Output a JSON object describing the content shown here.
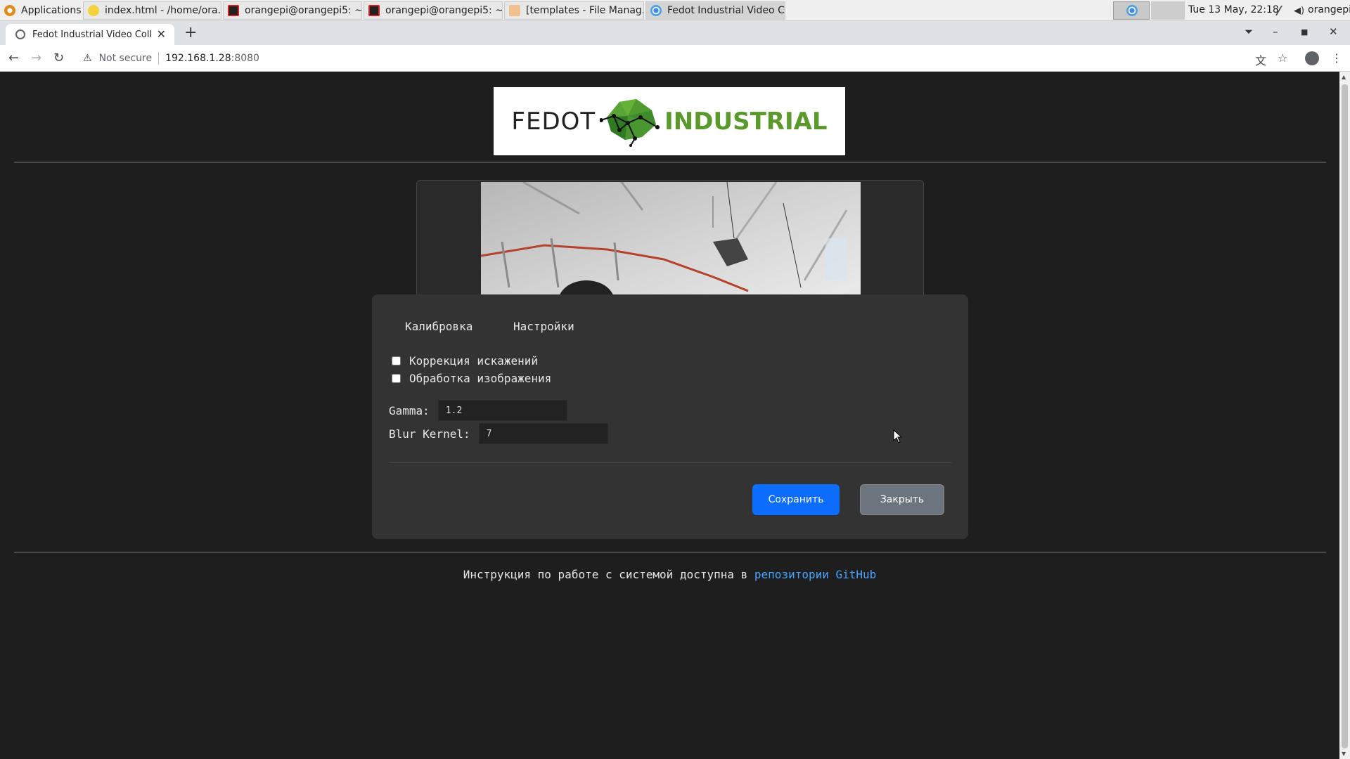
{
  "taskbar": {
    "items": [
      {
        "label": "Applications",
        "icon": "applications-icon"
      },
      {
        "label": "index.html - /home/ora...",
        "icon": "text-editor-icon"
      },
      {
        "label": "orangepi@orangepi5: ~",
        "icon": "terminal-icon"
      },
      {
        "label": "orangepi@orangepi5: ~...",
        "icon": "terminal-icon"
      },
      {
        "label": "[templates - File Manag...",
        "icon": "folder-icon"
      },
      {
        "label": "Fedot Industrial Video C...",
        "icon": "chrome-icon"
      }
    ],
    "clock": "Tue 13 May, 22:18",
    "user": "orangepi"
  },
  "browser": {
    "tab_title": "Fedot Industrial Video Coll",
    "security_label": "Not secure",
    "url_host": "192.168.1.28",
    "url_port": ":8080"
  },
  "page": {
    "logo": {
      "left": "FEDOT",
      "right": "INDUSTRIAL"
    },
    "footer_text": "Инструкция по работе с системой доступна в ",
    "footer_link": "репозитории GitHub"
  },
  "modal": {
    "tabs": [
      {
        "label": "Калибровка"
      },
      {
        "label": "Настройки"
      }
    ],
    "checkboxes": [
      {
        "label": "Коррекция искажений",
        "checked": false
      },
      {
        "label": "Обработка изображения",
        "checked": false
      }
    ],
    "gamma": {
      "label": "Gamma:",
      "value": "1.2"
    },
    "blur": {
      "label": "Blur Kernel:",
      "value": "7"
    },
    "save_label": "Сохранить",
    "close_label": "Закрыть"
  },
  "colors": {
    "page_bg": "#1e1e1e",
    "modal_bg": "#333333",
    "primary_button": "#0d6efd",
    "secondary_button": "#6c757d",
    "link": "#4aa3ff",
    "logo_green": "#5a9a2a"
  }
}
